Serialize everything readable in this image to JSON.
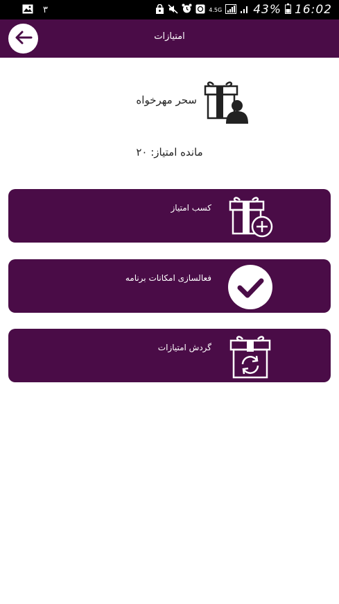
{
  "status_bar": {
    "notification_count": "٣",
    "network_type": "4.5G",
    "battery_percent": "43%",
    "time": "16:02"
  },
  "app_bar": {
    "title": "امتیازات"
  },
  "profile": {
    "name": "سحر مهرخواه"
  },
  "points": {
    "text": "مانده امتیاز: ۲۰"
  },
  "menu": [
    {
      "label": "کسب امتیاز",
      "icon": "gift-plus-icon"
    },
    {
      "label": "فعالسازی امکانات برنامه",
      "icon": "check-circle-icon"
    },
    {
      "label": "گردش امتیازات",
      "icon": "gift-refresh-icon"
    }
  ],
  "colors": {
    "primary": "#4a0c47",
    "status_bar": "#000000",
    "background": "#ffffff"
  }
}
